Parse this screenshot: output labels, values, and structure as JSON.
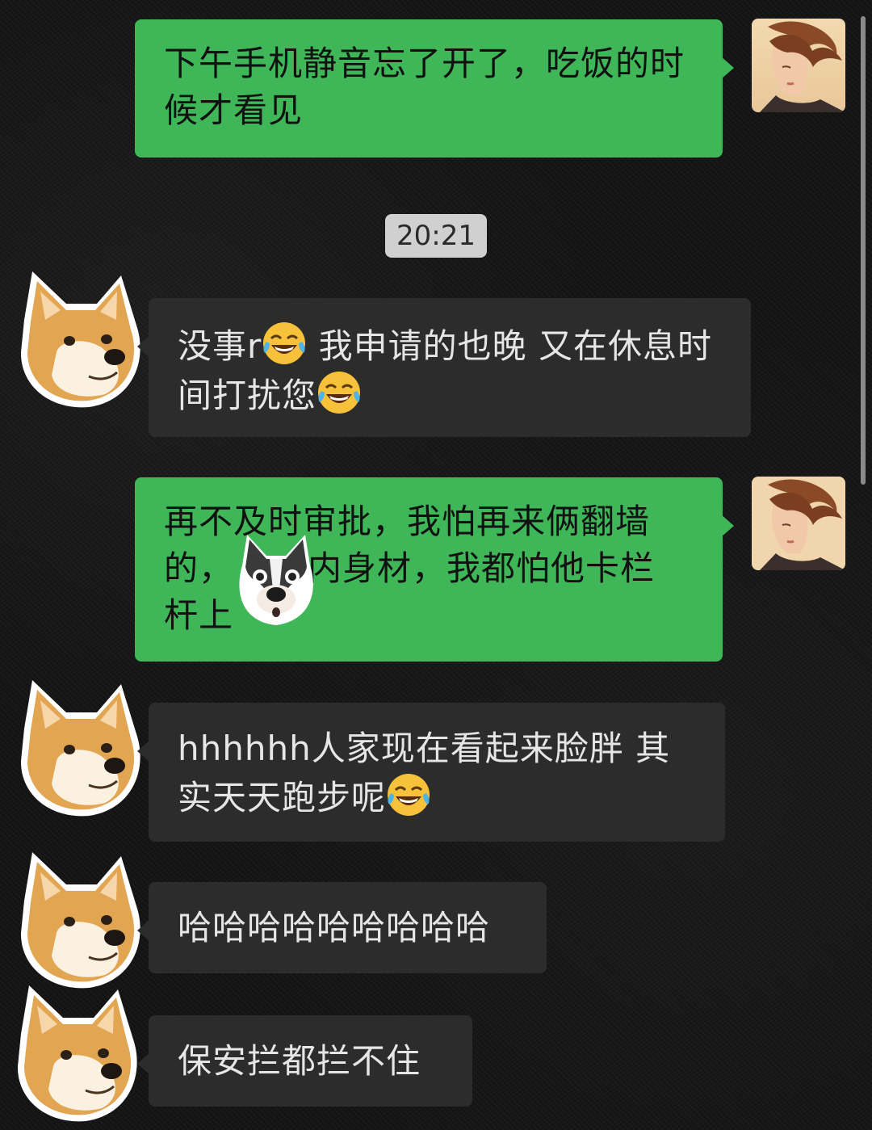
{
  "messages": [
    {
      "side": "outgoing",
      "text": "下午手机静音忘了开了，吃饭的时候才看见"
    },
    {
      "type": "timestamp",
      "text": "20:21"
    },
    {
      "side": "incoming",
      "text_a": "没事r",
      "text_b": "我申请的也晚 又在休息时间打扰您",
      "emoji": "face-with-tears-of-joy"
    },
    {
      "side": "outgoing",
      "line1": "再不及时审批，我怕再来俩翻墙",
      "line2_a": "的，",
      "line2_b": "内身材，我都怕他卡栏",
      "line3": "杆上",
      "sticker": "husky-face"
    },
    {
      "side": "incoming",
      "text": "hhhhhh人家现在看起来脸胖 其实天天跑步呢",
      "emoji": "face-with-tears-of-joy"
    },
    {
      "side": "incoming",
      "text": "哈哈哈哈哈哈哈哈哈"
    },
    {
      "side": "incoming",
      "text": "保安拦都拦不住"
    }
  ],
  "avatars": {
    "self": "girl-portrait-avatar",
    "other": "doge-avatar"
  },
  "colors": {
    "outgoing_bubble": "#3fb759",
    "incoming_bubble": "#2c2c2c",
    "background": "#151515"
  }
}
